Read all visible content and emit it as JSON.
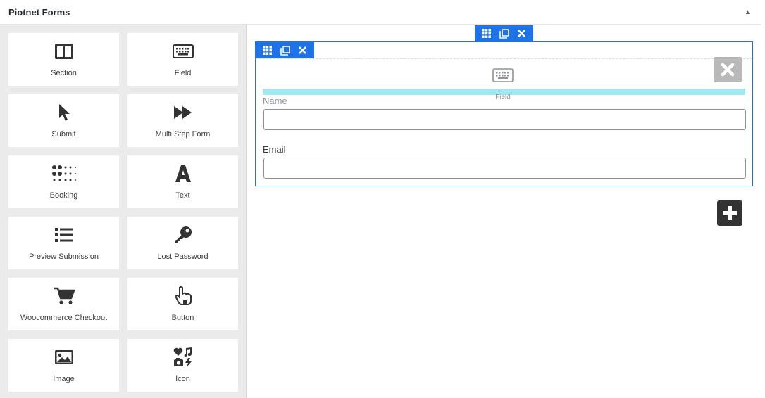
{
  "panel": {
    "title": "Piotnet Forms",
    "toggle_icon": "▲"
  },
  "widgets": [
    {
      "label": "Section",
      "icon": "section-icon"
    },
    {
      "label": "Field",
      "icon": "keyboard-icon"
    },
    {
      "label": "Submit",
      "icon": "cursor-icon"
    },
    {
      "label": "Multi Step Form",
      "icon": "fast-forward-icon"
    },
    {
      "label": "Booking",
      "icon": "dots-grid-icon"
    },
    {
      "label": "Text",
      "icon": "letter-a-icon"
    },
    {
      "label": "Preview Submission",
      "icon": "list-icon"
    },
    {
      "label": "Lost Password",
      "icon": "key-icon"
    },
    {
      "label": "Woocommerce Checkout",
      "icon": "cart-icon"
    },
    {
      "label": "Button",
      "icon": "hand-pointer-icon"
    },
    {
      "label": "Image",
      "icon": "image-icon"
    },
    {
      "label": "Icon",
      "icon": "icons-icon"
    }
  ],
  "canvas": {
    "drag_ghost_label": "Field",
    "fields": [
      {
        "label": "Name",
        "value": ""
      },
      {
        "label": "Email",
        "value": ""
      }
    ]
  },
  "colors": {
    "accent": "#1e73e8",
    "drop_indicator": "#9ee8f2",
    "sidebar_bg": "#ebebeb"
  }
}
